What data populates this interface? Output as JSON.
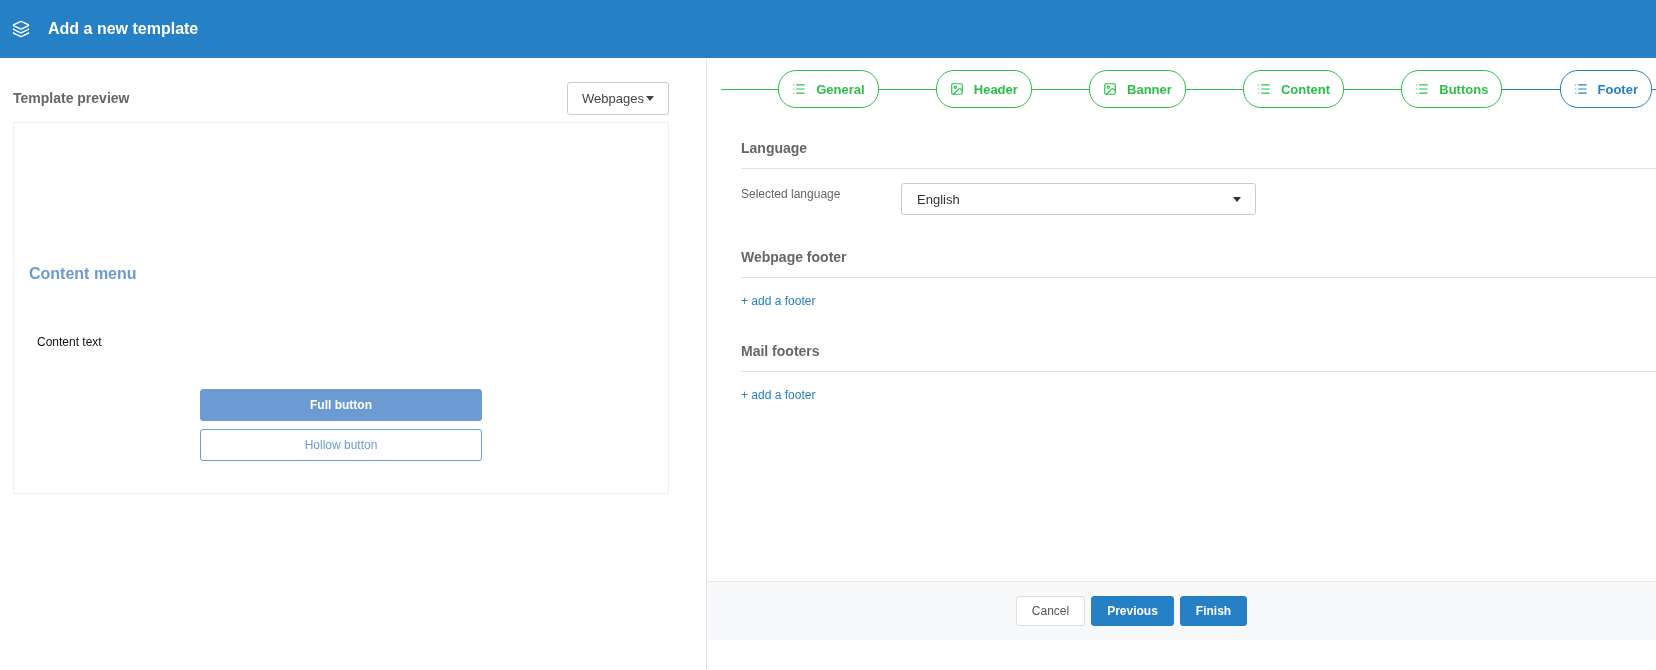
{
  "window": {
    "title": "Add a new template"
  },
  "preview": {
    "title": "Template preview",
    "dropdown": "Webpages",
    "content_title": "Content menu",
    "content_text": "Content text",
    "full_button": "Full button",
    "hollow_button": "Hollow button"
  },
  "steps": [
    {
      "label": "General",
      "kind": "list",
      "selected": false
    },
    {
      "label": "Header",
      "kind": "image",
      "selected": false
    },
    {
      "label": "Banner",
      "kind": "image",
      "selected": false
    },
    {
      "label": "Content",
      "kind": "list",
      "selected": false
    },
    {
      "label": "Buttons",
      "kind": "list",
      "selected": false
    },
    {
      "label": "Footer",
      "kind": "list",
      "selected": true
    }
  ],
  "sections": [
    {
      "title": "Language",
      "kind": "select",
      "label": "Selected language",
      "value": "English"
    },
    {
      "title": "Webpage footer",
      "kind": "link",
      "link": "+ add a footer"
    },
    {
      "title": "Mail footers",
      "kind": "link",
      "link": "+ add a footer"
    }
  ],
  "actions": [
    {
      "label": "Cancel",
      "kind": "secondary"
    },
    {
      "label": "Previous",
      "kind": "primary"
    },
    {
      "label": "Finish",
      "kind": "primary"
    }
  ]
}
